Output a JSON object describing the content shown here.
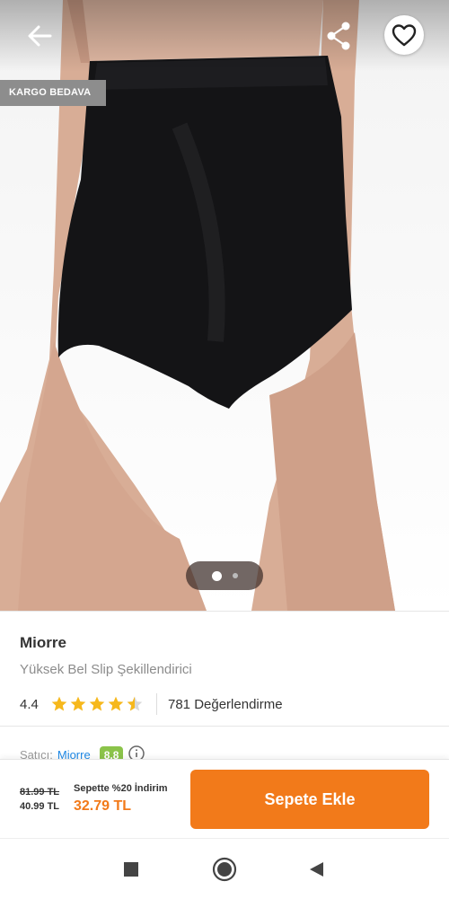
{
  "badge": {
    "cargo": "KARGO BEDAVA"
  },
  "product": {
    "brand": "Miorre",
    "name": "Yüksek Bel Slip Şekillendirici",
    "rating": "4.4",
    "rating_value": 4.4,
    "reviews": "781 Değerlendirme"
  },
  "seller": {
    "label": "Satıcı:",
    "name": "Miorre",
    "score": "8.8"
  },
  "pricing": {
    "old_price": "81.99 TL",
    "price": "40.99 TL",
    "discount_label": "Sepette %20 İndirim",
    "discount_price": "32.79 TL"
  },
  "actions": {
    "add_to_cart": "Sepete Ekle"
  },
  "gallery": {
    "page_count": 2,
    "current_page": 1
  },
  "colors": {
    "accent": "#f27a1a",
    "star": "#f6b81c",
    "seller_score": "#8bc34a",
    "link": "#1e88e5"
  },
  "icons": [
    "back-arrow-icon",
    "share-icon",
    "heart-icon",
    "star-icon",
    "info-icon",
    "square-nav-icon",
    "home-circle-icon",
    "back-triangle-icon"
  ]
}
